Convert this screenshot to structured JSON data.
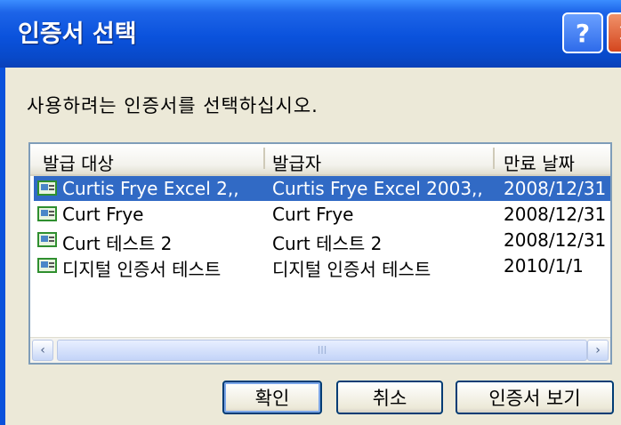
{
  "window": {
    "title": "인증서 선택"
  },
  "titlebar": {
    "help_label": "?",
    "close_label": "✕"
  },
  "instruction": "사용하려는 인증서를 선택하십시오.",
  "list": {
    "columns": [
      "발급 대상",
      "발급자",
      "만료 날짜"
    ],
    "selected_index": 0,
    "rows": [
      {
        "issued_to": "Curtis Frye Excel 2,,",
        "issuer": "Curtis Frye Excel 2003,,",
        "expires": "2008/12/31",
        "icon": "certificate-icon"
      },
      {
        "issued_to": "Curt Frye",
        "issuer": "Curt Frye",
        "expires": "2008/12/31",
        "icon": "certificate-icon"
      },
      {
        "issued_to": "Curt 테스트 2",
        "issuer": "Curt 테스트 2",
        "expires": "2008/12/31",
        "icon": "certificate-icon"
      },
      {
        "issued_to": "디지털 인증서 테스트",
        "issuer": "디지털 인증서 테스트",
        "expires": "2010/1/1",
        "icon": "certificate-icon"
      }
    ],
    "scroll": {
      "left_arrow": "‹",
      "right_arrow": "›",
      "thumb_grip": "III"
    }
  },
  "buttons": {
    "ok": "확인",
    "cancel": "취소",
    "view": "인증서 보기"
  },
  "colors": {
    "selection": "#316ac5",
    "titlebar": "#0a52dc",
    "dialog_bg": "#ece9d8"
  }
}
